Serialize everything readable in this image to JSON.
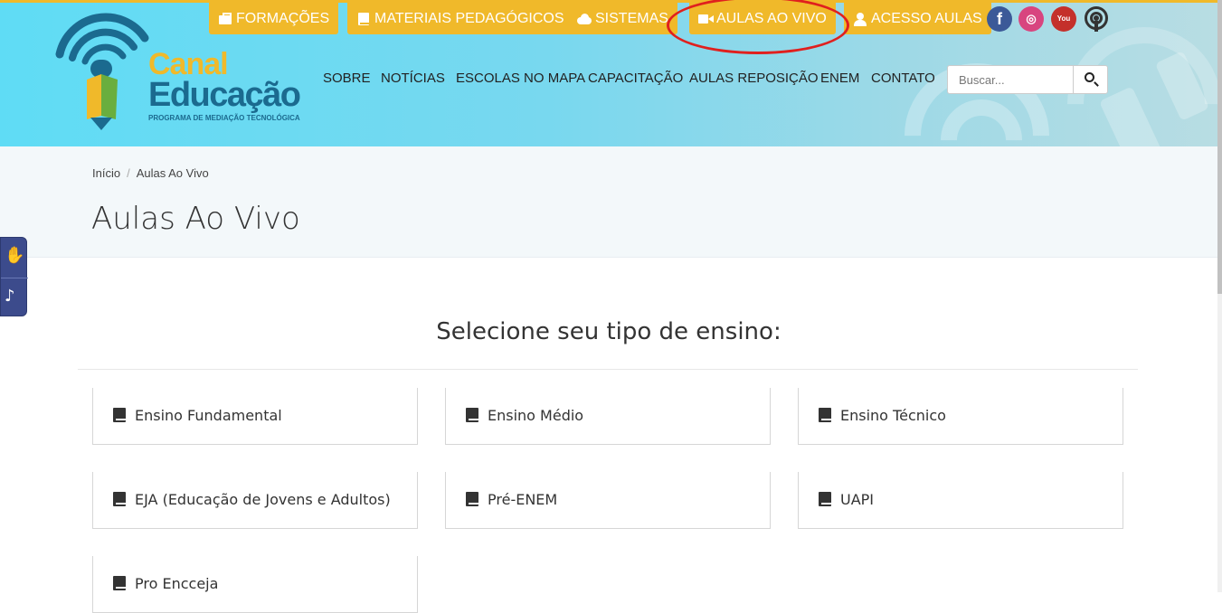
{
  "logo": {
    "line1": "Canal",
    "line2": "Educação",
    "tagline": "PROGRAMA DE MEDIAÇÃO TECNOLÓGICA"
  },
  "top_buttons": [
    {
      "label": "FORMAÇÕES",
      "icon": "briefcase-icon"
    },
    {
      "label": "MATERIAIS PEDAGÓGICOS",
      "icon": "book-icon"
    },
    {
      "label": "SISTEMAS",
      "icon": "cloud-icon"
    },
    {
      "label": "AULAS AO VIVO",
      "icon": "video-camera-icon",
      "highlighted": true
    },
    {
      "label": "ACESSO AULAS",
      "icon": "user-icon"
    }
  ],
  "social": {
    "facebook": "f",
    "instagram": "◎",
    "youtube": "You"
  },
  "nav": [
    "SOBRE",
    "NOTÍCIAS",
    "ESCOLAS NO MAPA",
    "CAPACITAÇÃO",
    "AULAS REPOSIÇÃO",
    "ENEM",
    "CONTATO"
  ],
  "search": {
    "placeholder": "Buscar..."
  },
  "breadcrumb": {
    "home": "Início",
    "current": "Aulas Ao Vivo"
  },
  "page_title": "Aulas Ao Vivo",
  "section_title": "Selecione seu tipo de ensino:",
  "cards": [
    "Ensino Fundamental",
    "Ensino Médio",
    "Ensino Técnico",
    "EJA (Educação de Jovens e Adultos)",
    "Pré-ENEM",
    "UAPI",
    "Pro Encceja"
  ],
  "colors": {
    "accent_yellow": "#f0b92a",
    "brand_blue": "#1b6a8f",
    "highlight_red": "#e0201e",
    "accessibility_bg": "#3c4b8c"
  }
}
